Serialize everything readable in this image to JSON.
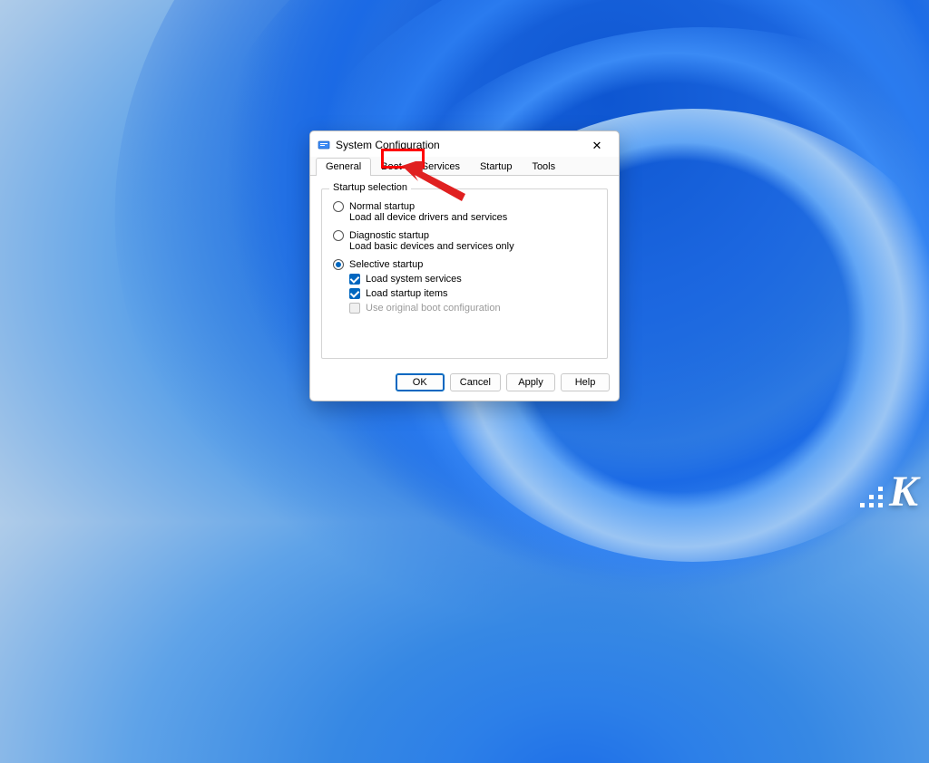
{
  "dialog": {
    "title": "System Configuration",
    "tabs": [
      "General",
      "Boot",
      "Services",
      "Startup",
      "Tools"
    ],
    "active_tab": "General",
    "highlighted_tab": "Services"
  },
  "group": {
    "legend": "Startup selection",
    "normal": {
      "label": "Normal startup",
      "sub": "Load all device drivers and services"
    },
    "diagnostic": {
      "label": "Diagnostic startup",
      "sub": "Load basic devices and services only"
    },
    "selective": {
      "label": "Selective startup",
      "option1": "Load system services",
      "option2": "Load startup items",
      "option3": "Use original boot configuration"
    },
    "selected": "selective",
    "checks": {
      "services": true,
      "startup": true,
      "original_boot": false
    }
  },
  "buttons": {
    "ok": "OK",
    "cancel": "Cancel",
    "apply": "Apply",
    "help": "Help"
  },
  "watermark": "K"
}
